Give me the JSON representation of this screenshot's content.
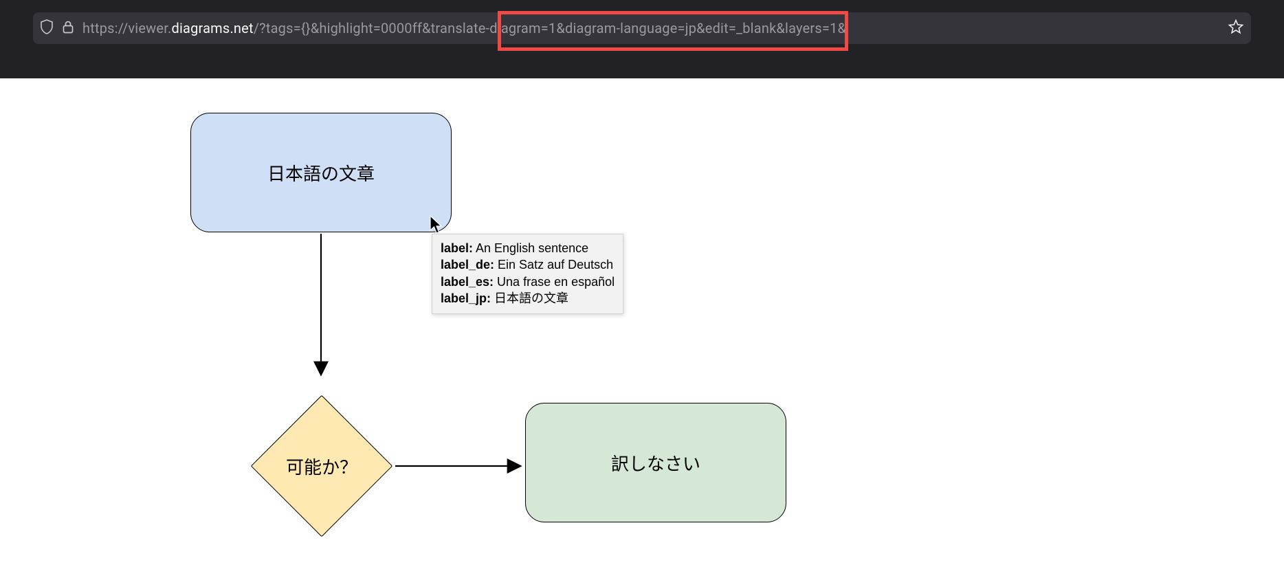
{
  "url": {
    "prefix_faded": "https://viewer.",
    "domain": "diagrams.net",
    "path_faded": "/?tags={}&highlight=0000ff&translate-diagram=1&diagram-language=jp&edit=_blank&layers=1&"
  },
  "diagram": {
    "nodes": {
      "start": {
        "label": "日本語の文章"
      },
      "decision": {
        "label": "可能か？"
      },
      "translate": {
        "label": "訳しなさい"
      }
    }
  },
  "tooltip": {
    "rows": [
      {
        "key": "label:",
        "val": " An English sentence"
      },
      {
        "key": "label_de:",
        "val": " Ein Satz auf Deutsch"
      },
      {
        "key": "label_es:",
        "val": " Una frase en español"
      },
      {
        "key": "label_jp:",
        "val": " 日本語の文章"
      }
    ]
  }
}
